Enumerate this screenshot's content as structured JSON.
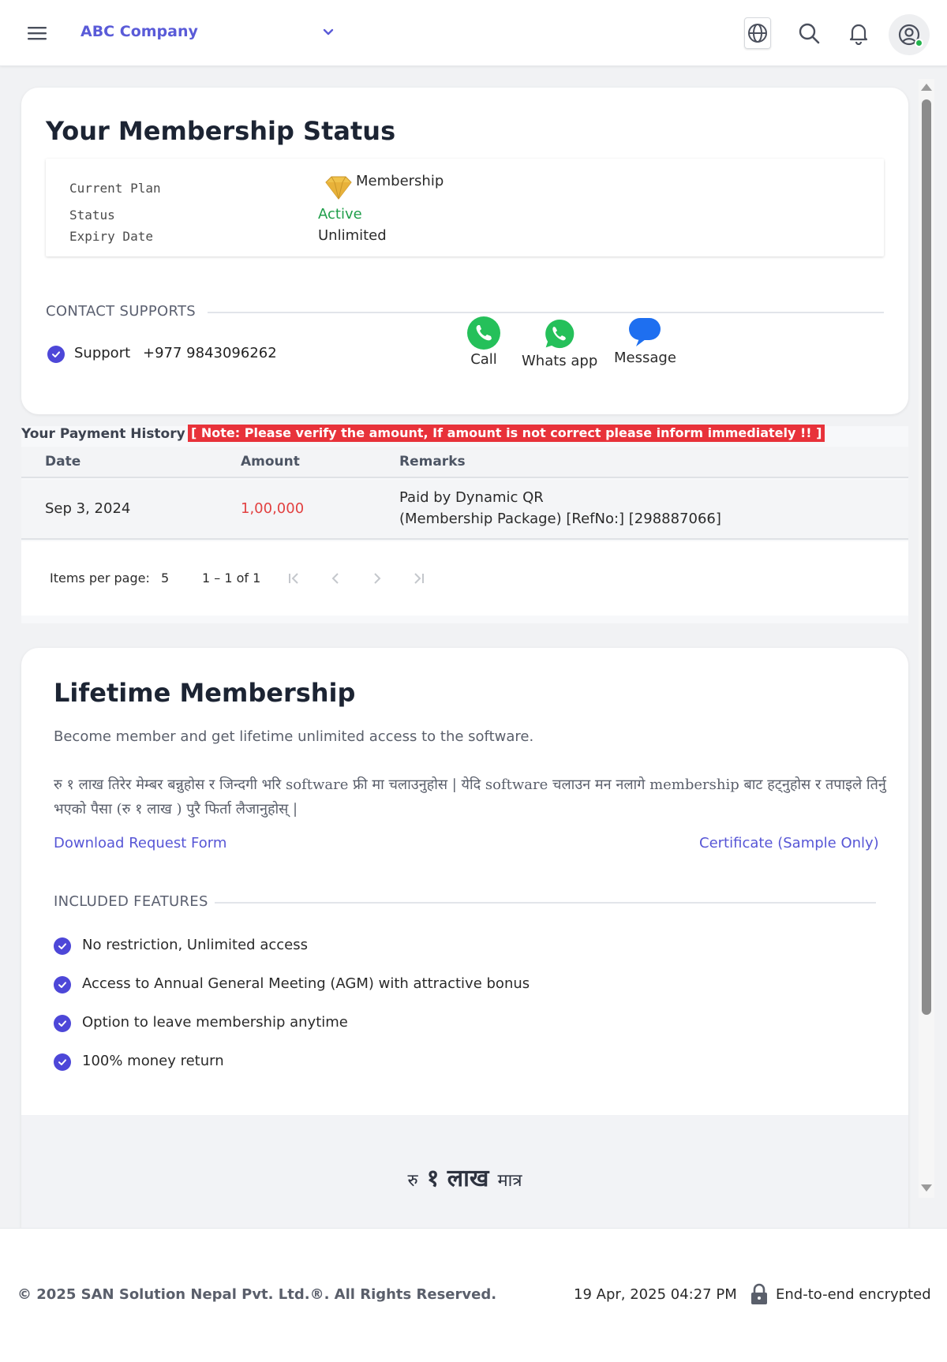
{
  "header": {
    "company": "ABC Company"
  },
  "membership_status": {
    "title": "Your Membership Status",
    "current_plan_label": "Current Plan",
    "current_plan_value": "Membership",
    "status_label": "Status",
    "status_value": "Active",
    "expiry_label": "Expiry Date",
    "expiry_value": "Unlimited"
  },
  "contact": {
    "heading": "CONTACT SUPPORTS",
    "support_label": "Support",
    "support_phone": "+977 9843096262",
    "buttons": [
      {
        "label": "Call",
        "icon": "phone-icon",
        "color": "#25c05a"
      },
      {
        "label": "Whats app",
        "icon": "whatsapp-icon",
        "color": "#25c05a"
      },
      {
        "label": "Message",
        "icon": "message-icon",
        "color": "#1e6ff0"
      }
    ]
  },
  "payment_history": {
    "title": "Your Payment History",
    "note": "[  Note: Please verify the amount, If amount is not correct please inform immediately !!  ]",
    "columns": [
      "Date",
      "Amount",
      "Remarks"
    ],
    "rows": [
      {
        "date": "Sep 3, 2024",
        "amount": "1,00,000",
        "remarks_line1": "Paid by Dynamic QR",
        "remarks_line2": "(Membership Package) [RefNo:] [298887066]"
      }
    ],
    "paginator": {
      "items_per_page_label": "Items per page:",
      "items_per_page_value": "5",
      "range": "1 – 1 of 1"
    }
  },
  "lifetime": {
    "title": "Lifetime Membership",
    "subtitle": "Become member and get lifetime unlimited access to the software.",
    "nepali_text": "रु १ लाख तिरेर मेम्बर बन्नुहोस र जिन्दगी भरि software फ्री मा चलाउनुहोस | येदि software चलाउन मन नलागे membership बाट हट्नुहोस र तपाइले तिर्नु भएको पैसा (रु १ लाख ) पुरै फिर्ता लैजानुहोस् |",
    "download_link": "Download Request Form",
    "certificate_link": "Certificate (Sample Only)",
    "features_heading": "INCLUDED FEATURES",
    "features": [
      "No restriction, Unlimited access",
      "Access to Annual General Meeting (AGM) with attractive bonus",
      "Option to leave membership anytime",
      "100% money return"
    ],
    "price_prefix": "रु",
    "price_amount": "१ लाख",
    "price_suffix": "मात्र"
  },
  "footer": {
    "copyright": "© 2025   SAN Solution Nepal Pvt. Ltd.®. All Rights Reserved.",
    "timestamp": "19 Apr, 2025 04:27 PM",
    "encryption": "End-to-end encrypted"
  },
  "colors": {
    "accent": "#5a5bd8",
    "active_green": "#1f9e4a",
    "note_red": "#e8323a",
    "amount_red": "#e24141"
  }
}
